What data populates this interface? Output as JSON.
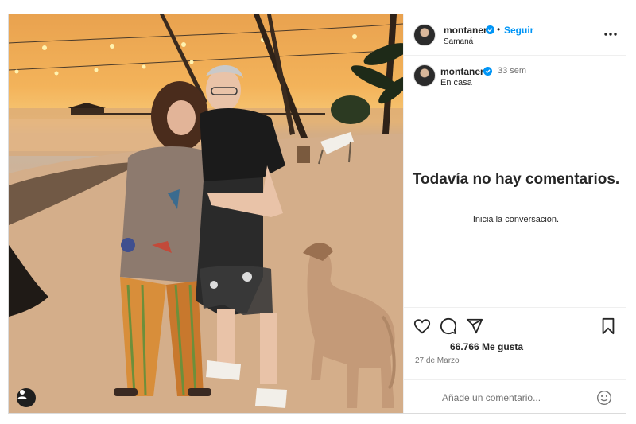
{
  "post": {
    "username": "montaner",
    "follow_label": "Seguir",
    "separator": "•",
    "location": "Samaná",
    "caption": {
      "username": "montaner",
      "time": "33 sem",
      "text": "En casa"
    },
    "comments_empty": {
      "title": "Todavía no hay comentarios.",
      "subtitle": "Inicia la conversación."
    },
    "likes": "66.766 Me gusta",
    "date": "27 de Marzo",
    "comment_placeholder": "Añade un comentario...",
    "icons": {
      "more": "more-options-icon",
      "like": "heart-icon",
      "comment": "comment-icon",
      "share": "share-icon",
      "save": "bookmark-icon",
      "emoji": "emoji-icon",
      "verified": "verified-badge-icon",
      "photo_user": "user-tag-icon"
    },
    "colors": {
      "accent": "#0095f6",
      "verified": "#0095f6",
      "text": "#262626",
      "muted": "#737373"
    }
  }
}
